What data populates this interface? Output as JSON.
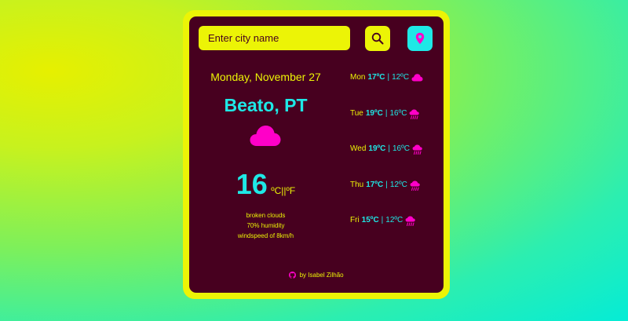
{
  "search": {
    "placeholder": "Enter city name"
  },
  "icons": {
    "search": "search-icon",
    "location": "location-pin-icon",
    "github": "github-icon",
    "cloud": "cloud-icon",
    "rain": "cloud-rain-icon"
  },
  "colors": {
    "yellow": "#ecf406",
    "maroon": "#47001f",
    "cyan": "#1ee8e6",
    "magenta": "#ff00c8"
  },
  "current": {
    "date": "Monday, November 27",
    "city": "Beato, PT",
    "temperature": "16",
    "units": "ºC||ºF",
    "description": "broken clouds",
    "humidity": "70% humidity",
    "wind": "windspeed of 8km/h"
  },
  "forecast": [
    {
      "day": "Mon",
      "high": "17ºC",
      "sep": "|",
      "low": "12ºC",
      "icon": "cloud-icon"
    },
    {
      "day": "Tue",
      "high": "19ºC",
      "sep": "|",
      "low": "16ºC",
      "icon": "cloud-rain-icon"
    },
    {
      "day": "Wed",
      "high": "19ºC",
      "sep": "|",
      "low": "16ºC",
      "icon": "cloud-rain-icon"
    },
    {
      "day": "Thu",
      "high": "17ºC",
      "sep": "|",
      "low": "12ºC",
      "icon": "cloud-rain-icon"
    },
    {
      "day": "Fri",
      "high": "15ºC",
      "sep": "|",
      "low": "12ºC",
      "icon": "cloud-rain-icon"
    }
  ],
  "footer": {
    "text": "by Isabel Zilhão"
  }
}
